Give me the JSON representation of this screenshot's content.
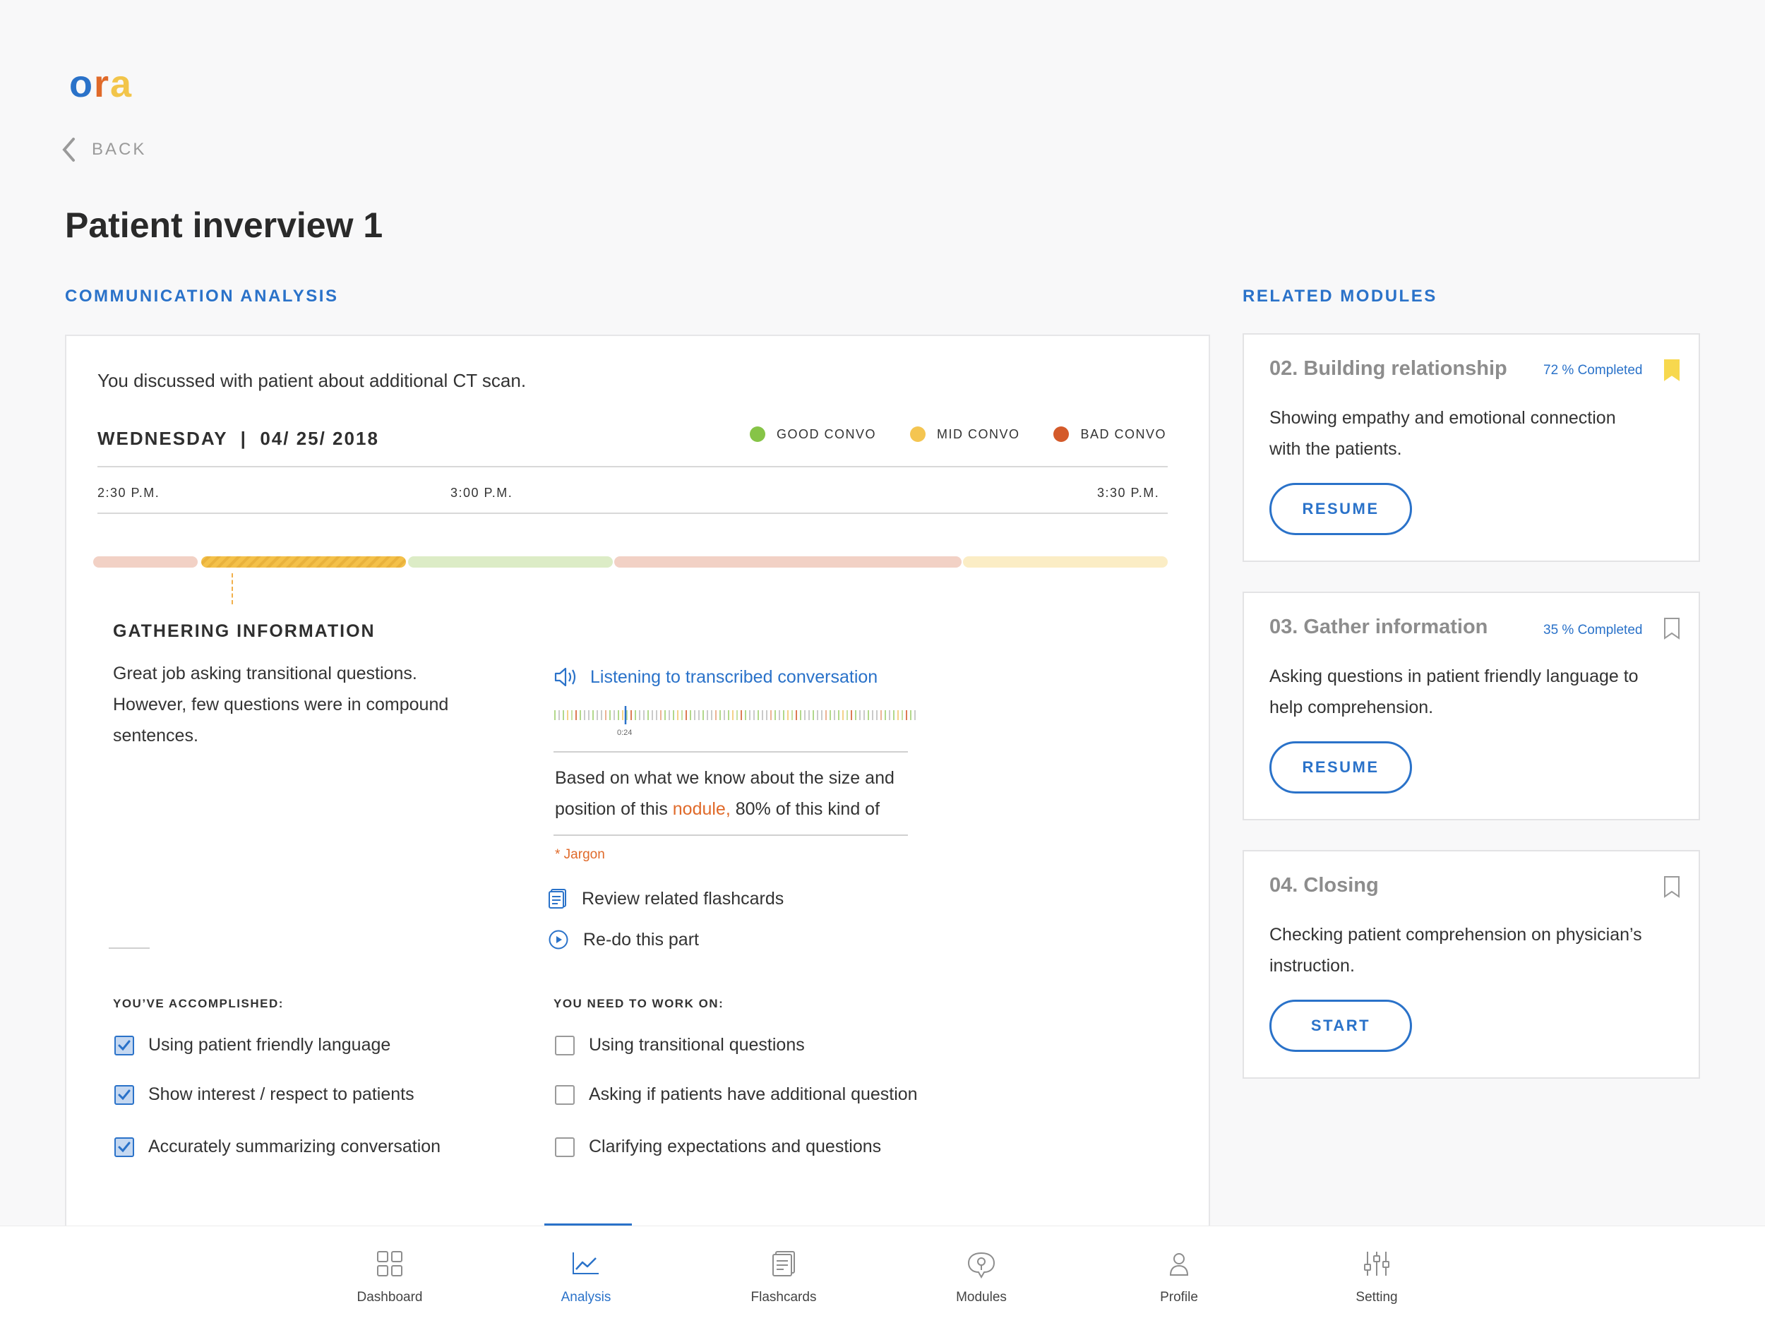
{
  "app": {
    "logo_letters": [
      "o",
      "r",
      "a"
    ],
    "back_label": "BACK",
    "page_title": "Patient inverview 1"
  },
  "analysis": {
    "section_label": "COMMUNICATION ANALYSIS",
    "summary": "You discussed with patient about additional CT scan.",
    "date_label": "WEDNESDAY  |  04/ 25/ 2018",
    "legend": [
      {
        "label": "GOOD CONVO",
        "color": "#86c447"
      },
      {
        "label": "MID CONVO",
        "color": "#f4c551"
      },
      {
        "label": "BAD CONVO",
        "color": "#d45a2a"
      }
    ],
    "times": [
      "2:30 P.M.",
      "3:00 P.M.",
      "3:30 P.M."
    ],
    "timeline_segments": [
      {
        "quality": "bad",
        "color": "#f2d1c5",
        "selected": false
      },
      {
        "quality": "mid",
        "color": "#f4c14a",
        "selected": true
      },
      {
        "quality": "good",
        "color": "#dcecc6",
        "selected": false
      },
      {
        "quality": "bad",
        "color": "#f2d1c5",
        "selected": false
      },
      {
        "quality": "mid",
        "color": "#fbedc5",
        "selected": false
      }
    ],
    "segment_title": "GATHERING INFORMATION",
    "feedback_line1": "Great job asking transitional questions.",
    "feedback_line2": "However, few questions were in compound",
    "feedback_line3": "sentences.",
    "listen_label": "Listening to transcribed conversation",
    "audio_time": "0:24",
    "transcript_line1": "Based on what we know about the size and",
    "transcript_line2_pre": "position of this ",
    "transcript_jargon": "nodule,",
    "transcript_line2_post": " 80% of this kind of",
    "jargon_note": "* Jargon",
    "actions": [
      {
        "label": "Review related flashcards",
        "icon": "flashcards-icon"
      },
      {
        "label": "Re-do this part",
        "icon": "play-circle-icon"
      }
    ],
    "accomplished_heading": "YOU’VE ACCOMPLISHED:",
    "accomplished": [
      {
        "label": "Using patient friendly language",
        "checked": true
      },
      {
        "label": "Show interest / respect to patients",
        "checked": true
      },
      {
        "label": "Accurately summarizing conversation",
        "checked": true
      }
    ],
    "work_heading": "YOU NEED TO WORK ON:",
    "work_on": [
      {
        "label": "Using transitional questions",
        "checked": false
      },
      {
        "label": "Asking if patients have additional question",
        "checked": false
      },
      {
        "label": "Clarifying expectations and questions",
        "checked": false
      }
    ]
  },
  "modules": {
    "section_label": "RELATED MODULES",
    "items": [
      {
        "title": "02. Building relationship",
        "completed": "72 % Completed",
        "bookmarked": true,
        "desc_line1": "Showing empathy and emotional connection",
        "desc_line2": "with the patients.",
        "button": "RESUME"
      },
      {
        "title": "03. Gather information",
        "completed": "35 % Completed",
        "bookmarked": false,
        "desc_line1": "Asking questions in patient friendly language to",
        "desc_line2": "help comprehension.",
        "button": "RESUME"
      },
      {
        "title": "04. Closing",
        "completed": "",
        "bookmarked": false,
        "desc_line1": "Checking patient comprehension on physician’s",
        "desc_line2": "instruction.",
        "button": "START"
      }
    ]
  },
  "nav": {
    "active": "Analysis",
    "items": [
      {
        "label": "Dashboard",
        "icon": "dashboard-icon"
      },
      {
        "label": "Analysis",
        "icon": "analysis-icon"
      },
      {
        "label": "Flashcards",
        "icon": "flashcards-icon"
      },
      {
        "label": "Modules",
        "icon": "modules-icon"
      },
      {
        "label": "Profile",
        "icon": "profile-icon"
      },
      {
        "label": "Setting",
        "icon": "setting-icon"
      }
    ]
  }
}
